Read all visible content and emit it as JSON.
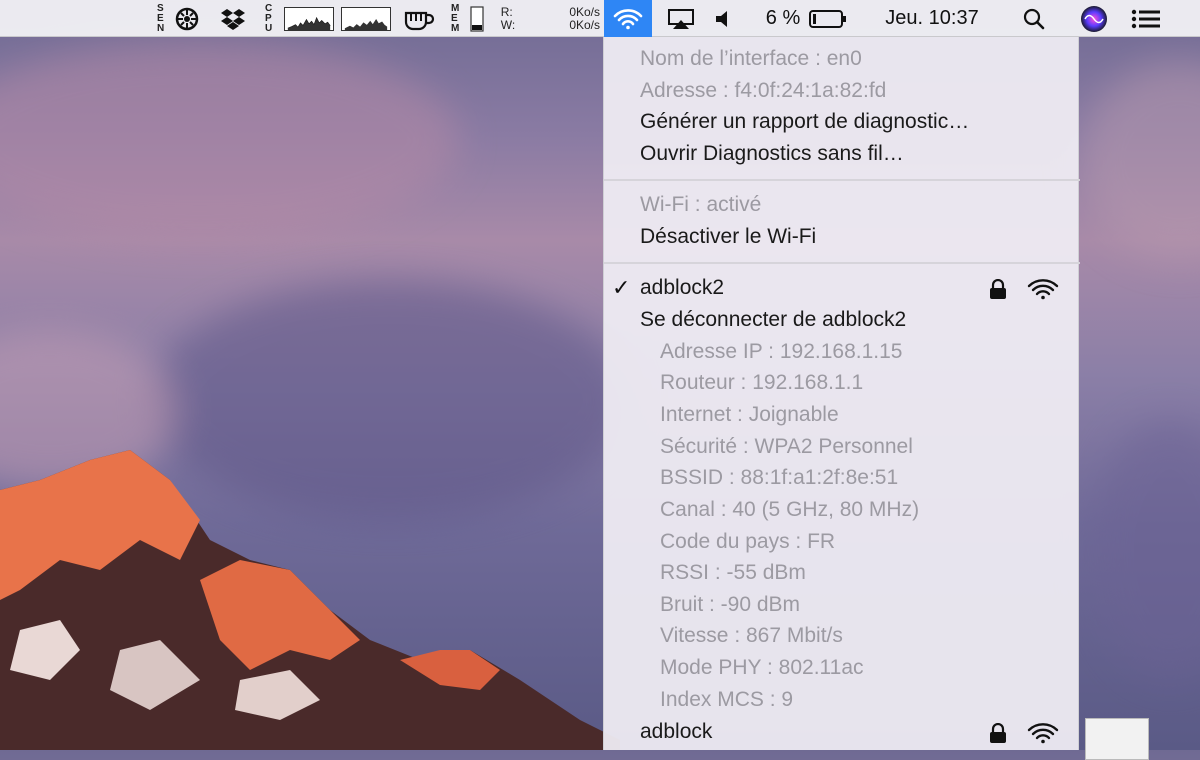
{
  "menubar": {
    "sensor_label": "SEN",
    "cpu_label": "CPU",
    "mem_label": "MEM",
    "read_label": "R:",
    "write_label": "W:",
    "read_value": "0Ko/s",
    "write_value": "0Ko/s",
    "battery_percent": "6 %",
    "clock": "Jeu. 10:37",
    "icons": [
      "sensor-fan-icon",
      "dropbox-icon",
      "cpu-graph-icon",
      "network-graph-icon",
      "coffee-cup-icon",
      "memory-meter-icon",
      "wifi-icon",
      "airplay-icon",
      "volume-icon",
      "battery-icon",
      "spotlight-search-icon",
      "siri-icon",
      "notification-center-icon"
    ]
  },
  "wifi_menu": {
    "interface_name": "Nom de l’interface : en0",
    "address": "Adresse : f4:0f:24:1a:82:fd",
    "generate_report": "Générer un rapport de diagnostic…",
    "open_diagnostics": "Ouvrir Diagnostics sans fil…",
    "wifi_status": "Wi-Fi : activé",
    "turn_off": "Désactiver le Wi-Fi",
    "current_network": {
      "check": "✓",
      "name": "adblock2",
      "disconnect": "Se déconnecter de adblock2",
      "details": [
        "Adresse IP : 192.168.1.15",
        "Routeur : 192.168.1.1",
        "Internet : Joignable",
        "Sécurité : WPA2 Personnel",
        "BSSID : 88:1f:a1:2f:8e:51",
        "Canal : 40 (5 GHz, 80 MHz)",
        "Code du pays : FR",
        "RSSI : -55 dBm",
        "Bruit : -90 dBm",
        "Vitesse : 867 Mbit/s",
        "Mode PHY : 802.11ac",
        "Index MCS : 9"
      ]
    },
    "other_network": "adblock"
  },
  "colors": {
    "accent": "#2e86f5",
    "dim_text": "#9c9aa2",
    "menu_bg": "#eeebf2"
  }
}
